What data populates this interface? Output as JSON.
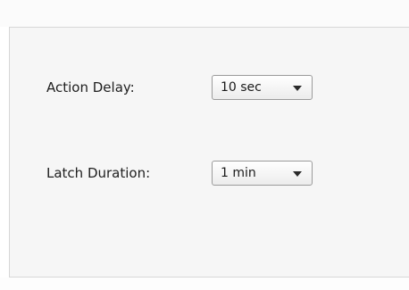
{
  "settings": {
    "action_delay": {
      "label": "Action Delay:",
      "selected": "10 sec",
      "icon": "chevron-down-icon"
    },
    "latch_duration": {
      "label": "Latch Duration:",
      "selected": "1 min",
      "icon": "chevron-down-icon"
    }
  }
}
